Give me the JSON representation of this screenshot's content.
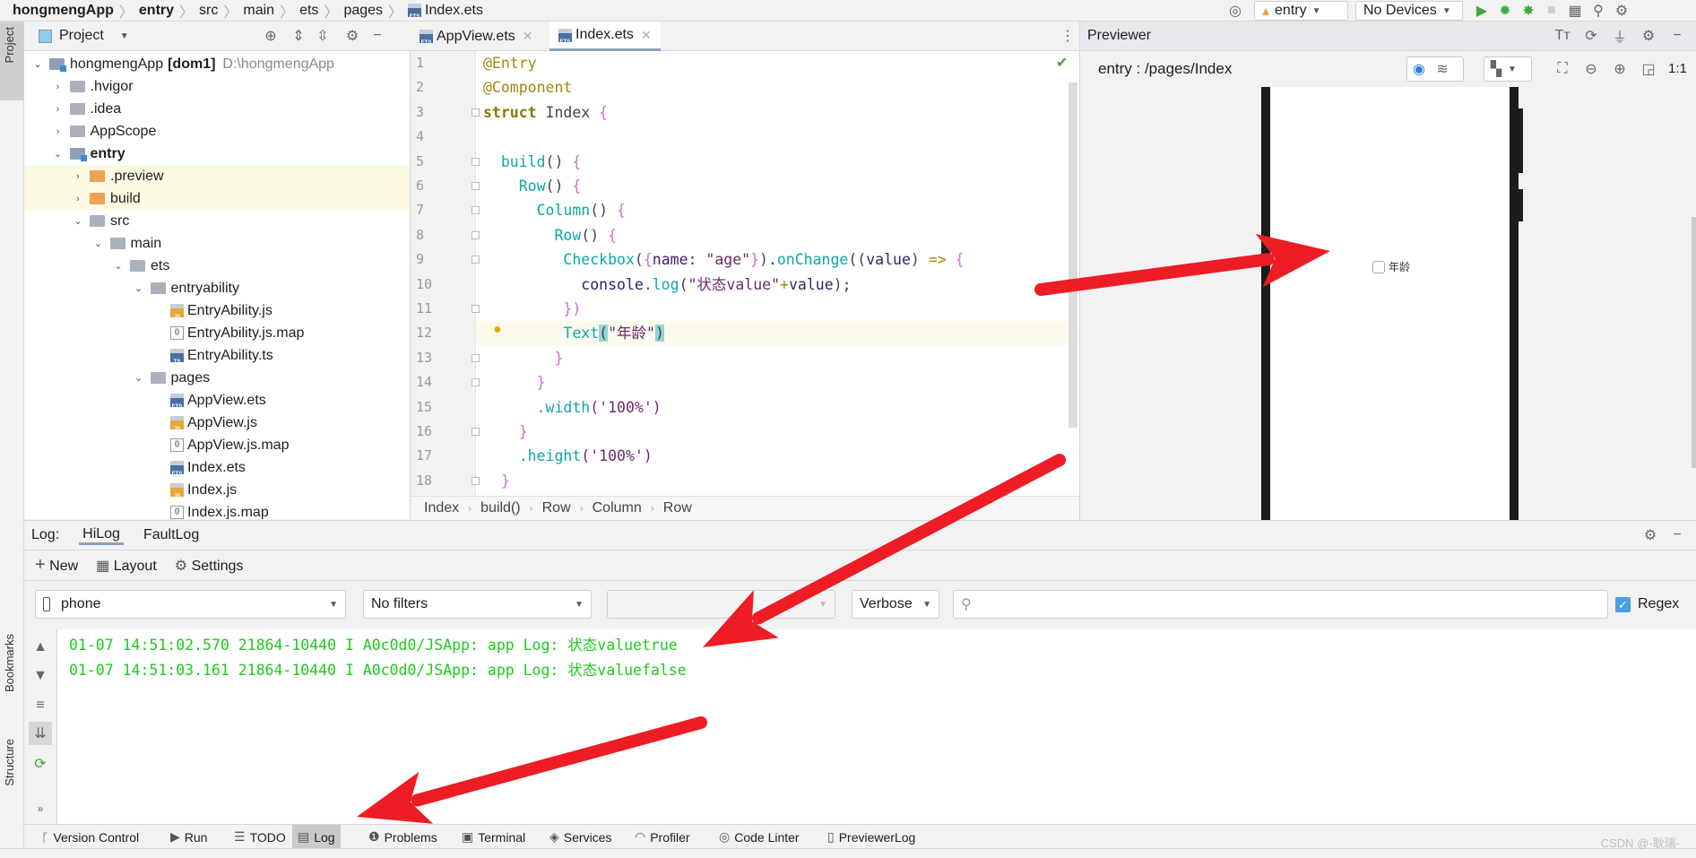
{
  "breadcrumb": [
    "hongmengApp",
    "entry",
    "src",
    "main",
    "ets",
    "pages",
    "Index.ets"
  ],
  "toolbar": {
    "run_config": "entry",
    "device": "No Devices"
  },
  "stripe": {
    "project": "Project",
    "bookmarks": "Bookmarks",
    "structure": "Structure"
  },
  "project": {
    "title": "Project",
    "tree": [
      {
        "label": "hongmengApp",
        "suffix": "[dom1]",
        "path": "D:\\hongmengApp",
        "level": 0,
        "kind": "module",
        "open": true
      },
      {
        "label": ".hvigor",
        "level": 1,
        "kind": "folder",
        "open": false
      },
      {
        "label": ".idea",
        "level": 1,
        "kind": "folder",
        "open": false
      },
      {
        "label": "AppScope",
        "level": 1,
        "kind": "folder",
        "open": false
      },
      {
        "label": "entry",
        "level": 1,
        "kind": "module",
        "open": true,
        "bold": true
      },
      {
        "label": ".preview",
        "level": 2,
        "kind": "orange",
        "open": false,
        "hl": true
      },
      {
        "label": "build",
        "level": 2,
        "kind": "orange",
        "open": false,
        "hl": true
      },
      {
        "label": "src",
        "level": 2,
        "kind": "folder",
        "open": true
      },
      {
        "label": "main",
        "level": 3,
        "kind": "folder",
        "open": true
      },
      {
        "label": "ets",
        "level": 4,
        "kind": "folder",
        "open": true
      },
      {
        "label": "entryability",
        "level": 5,
        "kind": "folder",
        "open": true
      },
      {
        "label": "EntryAbility.js",
        "level": 6,
        "kind": "js"
      },
      {
        "label": "EntryAbility.js.map",
        "level": 6,
        "kind": "map"
      },
      {
        "label": "EntryAbility.ts",
        "level": 6,
        "kind": "ts"
      },
      {
        "label": "pages",
        "level": 5,
        "kind": "folder",
        "open": true
      },
      {
        "label": "AppView.ets",
        "level": 6,
        "kind": "ets"
      },
      {
        "label": "AppView.js",
        "level": 6,
        "kind": "js"
      },
      {
        "label": "AppView.js.map",
        "level": 6,
        "kind": "map"
      },
      {
        "label": "Index.ets",
        "level": 6,
        "kind": "ets"
      },
      {
        "label": "Index.js",
        "level": 6,
        "kind": "js"
      },
      {
        "label": "Index.js.map",
        "level": 6,
        "kind": "map"
      }
    ]
  },
  "editor": {
    "tabs": [
      {
        "label": "AppView.ets",
        "active": false
      },
      {
        "label": "Index.ets",
        "active": true
      }
    ],
    "current_line": 12,
    "lines": [
      [
        [
          "@Entry",
          "ann"
        ]
      ],
      [
        [
          "@Component",
          "ann"
        ]
      ],
      [
        [
          "struct",
          "kw"
        ],
        [
          " Index ",
          "id"
        ],
        [
          "{",
          "br"
        ]
      ],
      [],
      [
        [
          "  build",
          "fn"
        ],
        [
          "() ",
          "p"
        ],
        [
          "{",
          "br"
        ]
      ],
      [
        [
          "    Row",
          "fn"
        ],
        [
          "() ",
          "p"
        ],
        [
          "{",
          "br"
        ]
      ],
      [
        [
          "      Column",
          "fn"
        ],
        [
          "() ",
          "p"
        ],
        [
          "{",
          "br"
        ]
      ],
      [
        [
          "        Row",
          "fn"
        ],
        [
          "() ",
          "p"
        ],
        [
          "{",
          "br"
        ]
      ],
      [
        [
          "         Checkbox",
          "fn"
        ],
        [
          "(",
          "p"
        ],
        [
          "{",
          "br"
        ],
        [
          "name",
          "name"
        ],
        [
          ": ",
          "p"
        ],
        [
          "\"age\"",
          "str"
        ],
        [
          "}",
          "br"
        ],
        [
          ").",
          "p"
        ],
        [
          "onChange",
          "fn"
        ],
        [
          "((",
          "p"
        ],
        [
          "value",
          "name"
        ],
        [
          ") ",
          "p"
        ],
        [
          "=>",
          "ann"
        ],
        [
          " ",
          "p"
        ],
        [
          "{",
          "br"
        ]
      ],
      [
        [
          "           console",
          "con"
        ],
        [
          ".",
          "p"
        ],
        [
          "log",
          "fn"
        ],
        [
          "(",
          "p"
        ],
        [
          "\"状态value\"",
          "str"
        ],
        [
          "+",
          "ann"
        ],
        [
          "value",
          "name"
        ],
        [
          ");",
          "p"
        ]
      ],
      [
        [
          "         ",
          "p"
        ],
        [
          "})",
          "br"
        ]
      ],
      [
        [
          "         Text",
          "fn"
        ],
        [
          "(",
          "mh"
        ],
        [
          "\"年龄\"",
          "str"
        ],
        [
          ")",
          "mh"
        ]
      ],
      [
        [
          "        ",
          "p"
        ],
        [
          "}",
          "br"
        ]
      ],
      [
        [
          "      ",
          "p"
        ],
        [
          "}",
          "br"
        ]
      ],
      [
        [
          "      .width",
          "fn"
        ],
        [
          "('100%')",
          "str"
        ]
      ],
      [
        [
          "    ",
          "p"
        ],
        [
          "}",
          "br"
        ]
      ],
      [
        [
          "    .height",
          "fn"
        ],
        [
          "('100%')",
          "str"
        ]
      ],
      [
        [
          "  ",
          "p"
        ],
        [
          "}",
          "br"
        ]
      ]
    ],
    "breadcrumb": [
      "Index",
      "build()",
      "Row",
      "Column",
      "Row"
    ]
  },
  "previewer": {
    "title": "Previewer",
    "route": "entry : /pages/Index",
    "zoom_label": "1:1",
    "checkbox_checked": false,
    "checkbox_label": "年龄"
  },
  "log": {
    "label": "Log:",
    "tabs": [
      {
        "label": "HiLog",
        "active": true
      },
      {
        "label": "FaultLog",
        "active": false
      }
    ],
    "actions": {
      "new": "New",
      "layout": "Layout",
      "settings": "Settings"
    },
    "device": "phone",
    "filter": "No filters",
    "process": "",
    "level": "Verbose",
    "search_value": "",
    "regex_label": "Regex",
    "regex_checked": true,
    "lines": [
      "01-07 14:51:02.570 21864-10440 I A0c0d0/JSApp: app Log: 状态valuetrue",
      "01-07 14:51:03.161 21864-10440 I A0c0d0/JSApp: app Log: 状态valuefalse"
    ],
    "color": "#1ec91e"
  },
  "bottom_tools": [
    {
      "label": "Version Control",
      "icon": "branch-icon"
    },
    {
      "label": "Run",
      "icon": "play-icon"
    },
    {
      "label": "TODO",
      "icon": "list-icon"
    },
    {
      "label": "Log",
      "icon": "log-icon",
      "active": true
    },
    {
      "label": "Problems",
      "icon": "warning-icon"
    },
    {
      "label": "Terminal",
      "icon": "terminal-icon"
    },
    {
      "label": "Services",
      "icon": "services-icon"
    },
    {
      "label": "Profiler",
      "icon": "gauge-icon"
    },
    {
      "label": "Code Linter",
      "icon": "linter-icon"
    },
    {
      "label": "PreviewerLog",
      "icon": "document-icon"
    }
  ],
  "watermark": "CSDN @-耿瑞-",
  "annotation_color": "#ee1c25"
}
